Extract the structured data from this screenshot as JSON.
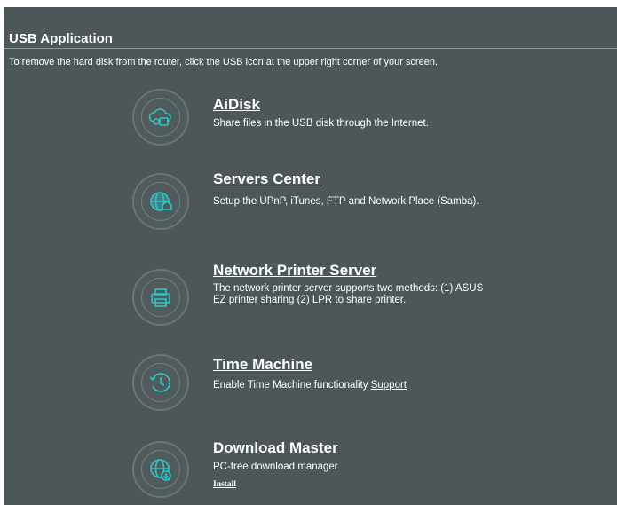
{
  "header": {
    "title": "USB Application",
    "note": "To remove the hard disk from the router, click the USB icon at the upper right corner of your screen."
  },
  "colors": {
    "background": "#4d5659",
    "icon_accent": "#2ec4c4",
    "text": "#ffffff"
  },
  "apps": [
    {
      "title": "AiDisk",
      "description": "Share files in the USB disk through the Internet.",
      "icon": "cloud-disk-icon"
    },
    {
      "title": "Servers Center",
      "description": "Setup the UPnP, iTunes, FTP and Network Place (Samba).",
      "icon": "globe-house-icon"
    },
    {
      "title": "Network Printer Server",
      "description": "The network printer server supports two methods: (1) ASUS EZ printer sharing (2) LPR to share printer.",
      "icon": "printer-icon"
    },
    {
      "title": "Time Machine",
      "description": "Enable Time Machine functionality",
      "link": "Support",
      "icon": "clock-icon"
    },
    {
      "title": "Download Master",
      "description": "PC-free download manager",
      "link": "Install",
      "icon": "globe-download-icon"
    }
  ]
}
